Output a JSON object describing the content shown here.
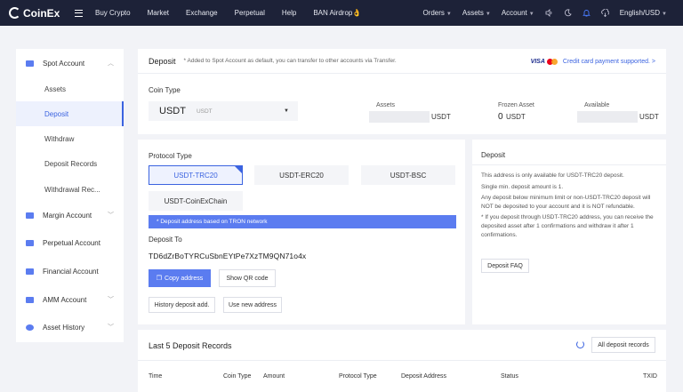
{
  "brand": {
    "logo_text": "CoinEx"
  },
  "nav": {
    "left": [
      "Buy Crypto",
      "Market",
      "Exchange",
      "Perpetual",
      "Help",
      "BAN Airdrop👌"
    ],
    "right": {
      "orders": "Orders",
      "assets": "Assets",
      "account": "Account",
      "language": "English/USD"
    }
  },
  "sidebar": {
    "spot_account": "Spot Account",
    "assets": "Assets",
    "deposit": "Deposit",
    "withdraw": "Withdraw",
    "deposit_records": "Deposit Records",
    "withdrawal_records": "Withdrawal Rec...",
    "margin_account": "Margin Account",
    "perpetual_account": "Perpetual Account",
    "financial_account": "Financial Account",
    "amm_account": "AMM Account",
    "asset_history": "Asset History"
  },
  "deposit_header": {
    "title": "Deposit",
    "note": "* Added to Spot Account as default, you can transfer to other accounts via Transfer.",
    "visa": "VISA",
    "card_link": "Credit card payment supported. >"
  },
  "coin": {
    "label": "Coin Type",
    "selected": "USDT",
    "sub": "USDT"
  },
  "balances": {
    "assets_label": "Assets",
    "assets_unit": "USDT",
    "frozen_label": "Frozen Asset",
    "frozen_value": "0",
    "frozen_unit": "USDT",
    "available_label": "Available",
    "available_unit": "USDT"
  },
  "protocol": {
    "label": "Protocol Type",
    "options": [
      "USDT-TRC20",
      "USDT-ERC20",
      "USDT-BSC",
      "USDT-CoinExChain"
    ],
    "note": "* Deposit address based on TRON network"
  },
  "deposit_to": {
    "label": "Deposit To",
    "address": "TD6dZrBoTYRCuSbnEYtPe7XzTM9QN71o4x",
    "copy": "Copy address",
    "qr": "Show QR code",
    "history": "History deposit add.",
    "new_address": "Use new address"
  },
  "info": {
    "title": "Deposit",
    "line1": "This address is only available for USDT-TRC20 deposit.",
    "line2": "Single min. deposit amount is 1.",
    "line3": "Any deposit below minimum limit or non-USDT-TRC20 deposit will NOT be deposited to your account and it is NOT refundable.",
    "line4": "* If you deposit through USDT-TRC20 address, you can receive the deposited asset after 1 confirmations and withdraw it after 1 confirmations.",
    "faq": "Deposit FAQ"
  },
  "records": {
    "title": "Last 5 Deposit Records",
    "all": "All deposit records",
    "columns": [
      "Time",
      "Coin Type",
      "Amount",
      "Protocol Type",
      "Deposit Address",
      "Status",
      "TXID"
    ]
  },
  "colors": {
    "accent": "#5b7cf0",
    "nav_bg": "#1d2238",
    "link": "#3b63e0"
  }
}
